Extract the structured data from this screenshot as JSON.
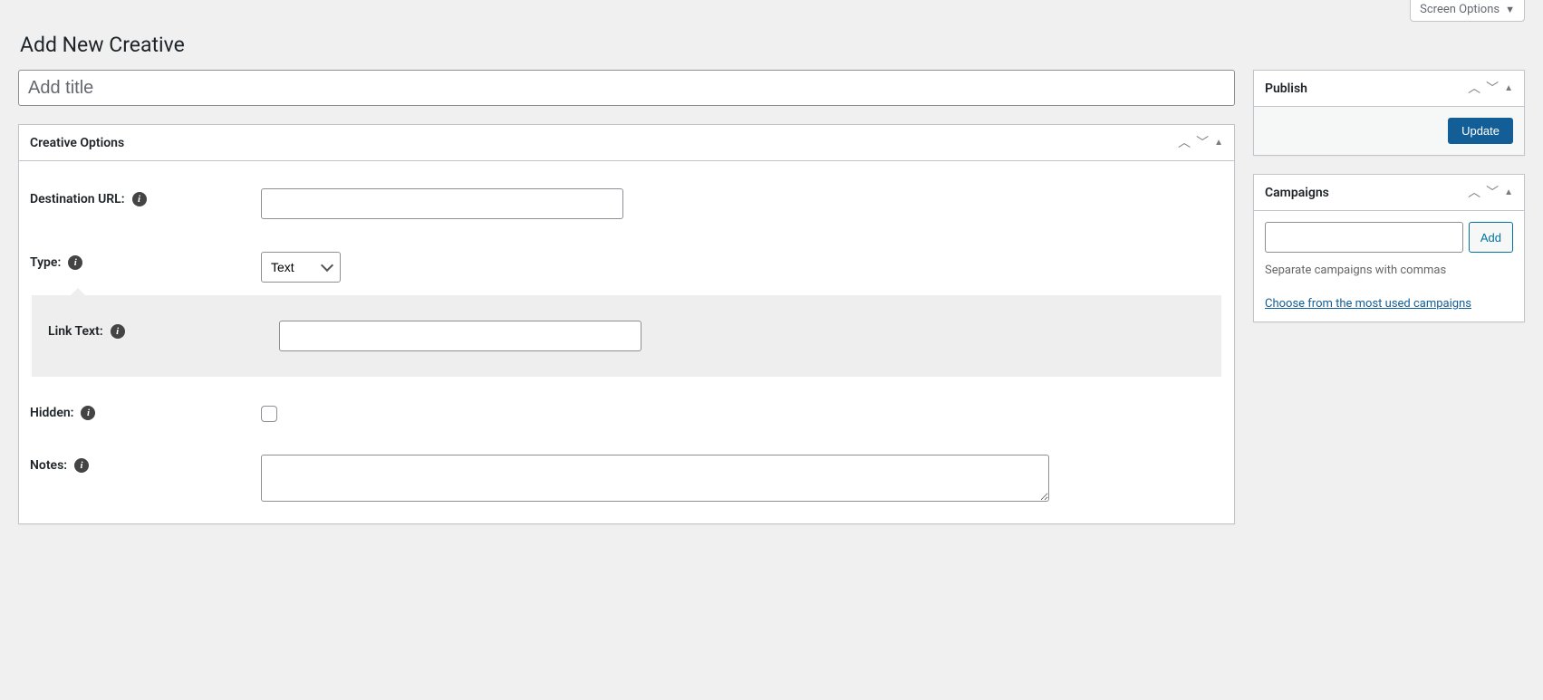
{
  "screenOptions": {
    "label": "Screen Options"
  },
  "pageTitle": "Add New Creative",
  "titleField": {
    "placeholder": "Add title",
    "value": ""
  },
  "creativeOptions": {
    "heading": "Creative Options",
    "destinationUrl": {
      "label": "Destination URL:",
      "value": ""
    },
    "type": {
      "label": "Type:",
      "selected": "Text"
    },
    "linkText": {
      "label": "Link Text:",
      "value": ""
    },
    "hidden": {
      "label": "Hidden:",
      "checked": false
    },
    "notes": {
      "label": "Notes:",
      "value": ""
    }
  },
  "publish": {
    "heading": "Publish",
    "button": "Update"
  },
  "campaigns": {
    "heading": "Campaigns",
    "inputValue": "",
    "addButton": "Add",
    "help": "Separate campaigns with commas",
    "chooseLink": "Choose from the most used campaigns"
  }
}
